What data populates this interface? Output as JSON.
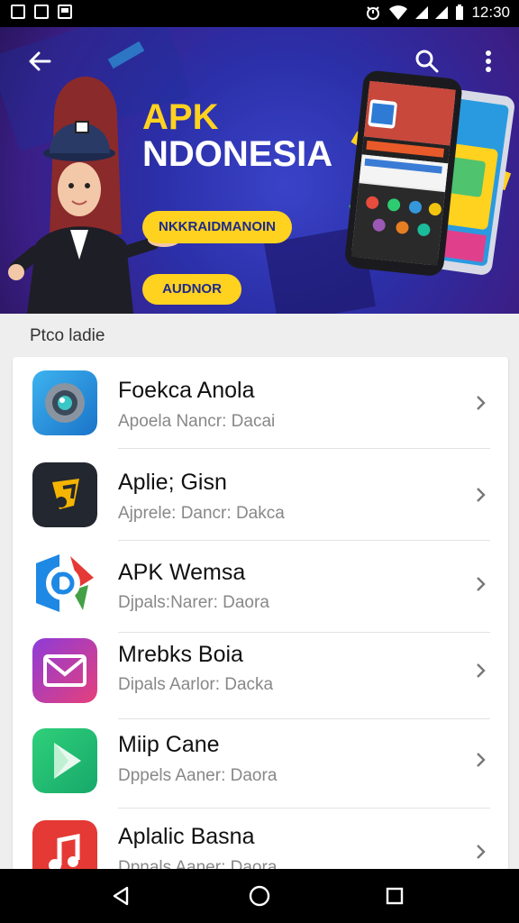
{
  "status_bar": {
    "time": "12:30"
  },
  "banner": {
    "title_line1": "APK",
    "title_line2": "NDONESIA",
    "pill1": "NKKRAIDMANOIN",
    "pill2": "AUDNOR"
  },
  "section": {
    "header": "Ptco ladie"
  },
  "apps": [
    {
      "title": "Foekca Anola",
      "subtitle": "Apoela Nancr: Dacai"
    },
    {
      "title": "Aplie; Gisn",
      "subtitle": "Ajprele: Dancr: Dakca"
    },
    {
      "title": "APK Wemsa",
      "subtitle": "Djpals:Narer: Daora"
    },
    {
      "title": "Mrebks Boia",
      "subtitle": "Dipals Aarlor: Dacka"
    },
    {
      "title": "Miip Cane",
      "subtitle": "Dppels Aaner: Daora"
    },
    {
      "title": "Aplalic Basna",
      "subtitle": "Dpnals Aaner: Daora"
    }
  ]
}
